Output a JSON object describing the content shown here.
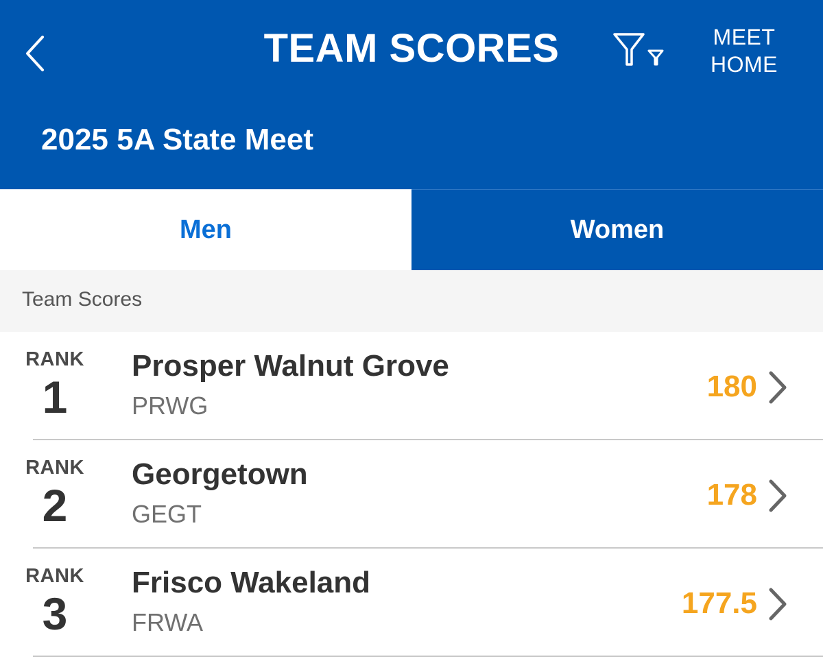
{
  "header": {
    "title": "TEAM SCORES",
    "meet_home_line1": "MEET",
    "meet_home_line2": "HOME",
    "meet_name": "2025 5A State Meet",
    "back_icon": "chevron-left-icon",
    "filter_icon": "filter-icon"
  },
  "tabs": [
    {
      "label": "Men",
      "active": true
    },
    {
      "label": "Women",
      "active": false
    }
  ],
  "section": {
    "title": "Team Scores"
  },
  "rank_label": "RANK",
  "teams": [
    {
      "rank": "1",
      "name": "Prosper Walnut Grove",
      "code": "PRWG",
      "score": "180"
    },
    {
      "rank": "2",
      "name": "Georgetown",
      "code": "GEGT",
      "score": "178"
    },
    {
      "rank": "3",
      "name": "Frisco Wakeland",
      "code": "FRWA",
      "score": "177.5"
    }
  ],
  "colors": {
    "primary": "#0057b0",
    "active_tab_text": "#0a6fd6",
    "score": "#f5a51f",
    "section_bg": "#f5f5f5"
  }
}
